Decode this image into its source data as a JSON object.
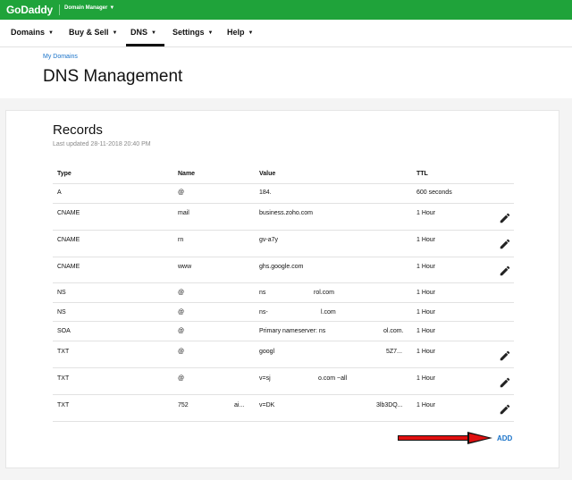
{
  "app": {
    "logo": "GoDaddy",
    "domain_manager": "Domain Manager"
  },
  "nav": {
    "items": [
      {
        "label": "Domains"
      },
      {
        "label": "Buy & Sell"
      },
      {
        "label": "DNS"
      },
      {
        "label": "Settings"
      },
      {
        "label": "Help"
      }
    ],
    "active": "DNS"
  },
  "header": {
    "breadcrumb": "My Domains",
    "title": "DNS Management"
  },
  "records": {
    "title": "Records",
    "last_updated": "Last updated 28-11-2018 20:40 PM",
    "columns": {
      "type": "Type",
      "name": "Name",
      "value": "Value",
      "ttl": "TTL"
    },
    "rows": [
      {
        "type": "A",
        "name": "@",
        "value": "184.",
        "ttl": "600 seconds",
        "editable": false
      },
      {
        "type": "CNAME",
        "name": "mail",
        "value": "business.zoho.com",
        "ttl": "1 Hour",
        "editable": true
      },
      {
        "type": "CNAME",
        "name": "rn",
        "value": "gv-a7y",
        "ttl": "1 Hour",
        "editable": true
      },
      {
        "type": "CNAME",
        "name": "www",
        "value": "ghs.google.com",
        "ttl": "1 Hour",
        "editable": true
      },
      {
        "type": "NS",
        "name": "@",
        "value": "ns",
        "value_tail": "rol.com",
        "ttl": "1 Hour",
        "editable": false
      },
      {
        "type": "NS",
        "name": "@",
        "value": "ns-",
        "value_tail": "l.com",
        "ttl": "1 Hour",
        "editable": false
      },
      {
        "type": "SOA",
        "name": "@",
        "value": "Primary nameserver: ns",
        "value_tail": "ol.com.",
        "ttl": "1 Hour",
        "editable": false
      },
      {
        "type": "TXT",
        "name": "@",
        "value": "googl",
        "value_tail": "5Z7...",
        "ttl": "1 Hour",
        "editable": true
      },
      {
        "type": "TXT",
        "name": "@",
        "value": "v=sj",
        "value_tail": "o.com ~all",
        "ttl": "1 Hour",
        "editable": true
      },
      {
        "type": "TXT",
        "name": "752",
        "name_tail": "ai...",
        "value": "v=DK",
        "value_tail": "3lb3DQ...",
        "ttl": "1 Hour",
        "editable": true
      }
    ],
    "add_label": "ADD"
  },
  "colors": {
    "brand_green": "#1fa33a",
    "link_blue": "#1a73c9",
    "arrow_red": "#e01010"
  },
  "icons": {
    "edit": "pencil-icon",
    "nav_caret": "chevron-down-icon"
  }
}
